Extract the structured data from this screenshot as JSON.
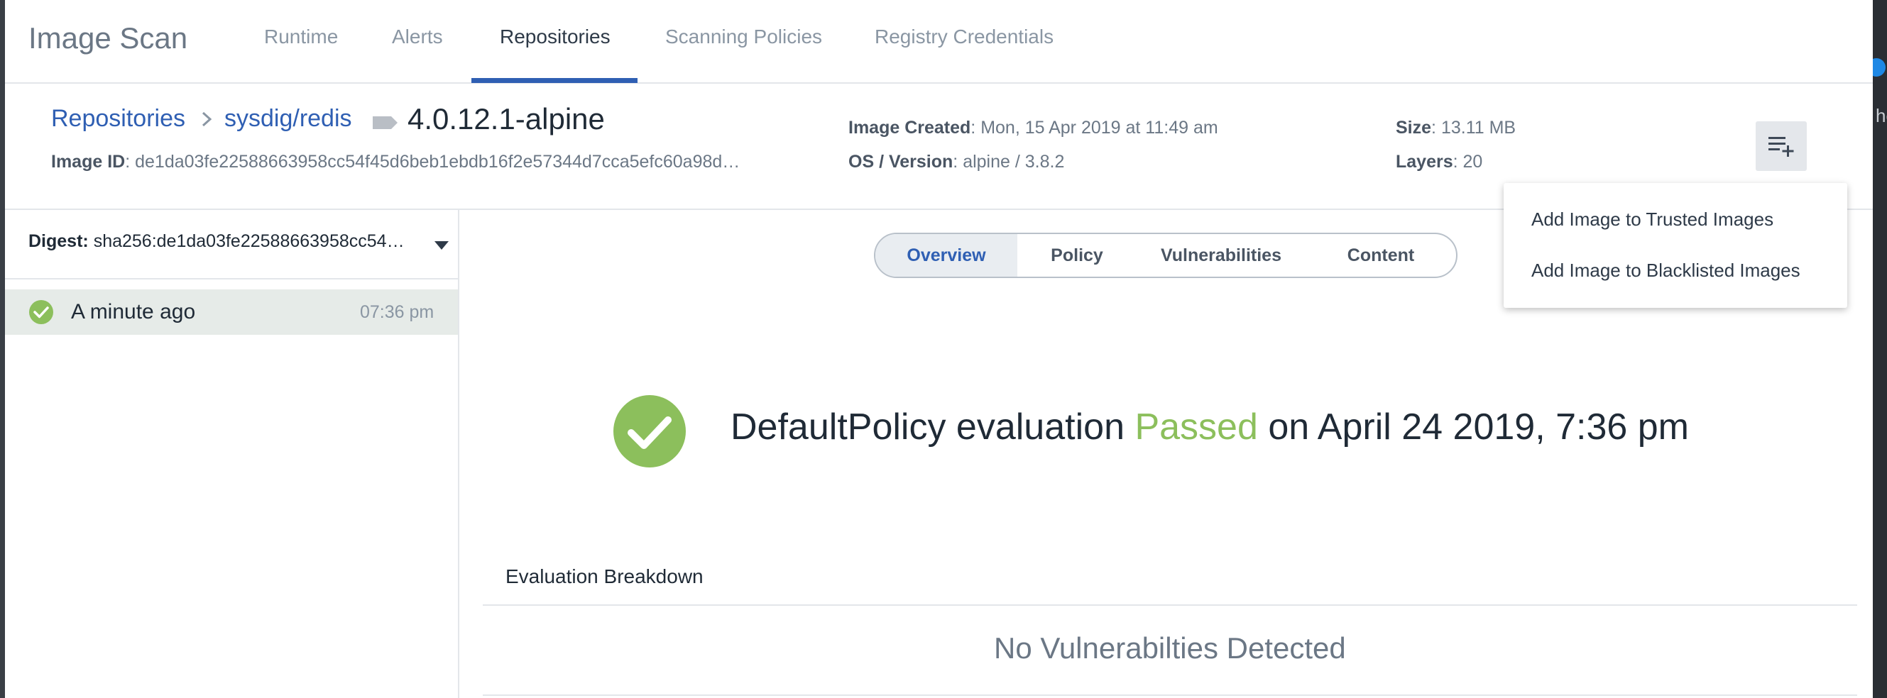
{
  "app": {
    "title": "Image Scan"
  },
  "nav": {
    "tabs": [
      {
        "label": "Runtime"
      },
      {
        "label": "Alerts"
      },
      {
        "label": "Repositories"
      },
      {
        "label": "Scanning Policies"
      },
      {
        "label": "Registry Credentials"
      }
    ],
    "active_tab": "Repositories"
  },
  "header": {
    "breadcrumb": {
      "root": "Repositories",
      "repo": "sysdig/redis"
    },
    "image_tag": "4.0.12.1-alpine",
    "image_id_label": "Image ID",
    "image_id_value": "de1da03fe22588663958cc54f45d6beb1ebdb16f2e57344d7cca5efc60a98d…",
    "created_label": "Image Created",
    "created_value": "Mon, 15 Apr 2019 at 11:49 am",
    "os_label": "OS / Version",
    "os_value": "alpine / 3.8.2",
    "size_label": "Size",
    "size_value": "13.11 MB",
    "layers_label": "Layers",
    "layers_value": "20"
  },
  "actions_menu": {
    "icon": "playlist-add-icon",
    "items": [
      {
        "label": "Add Image to Trusted Images"
      },
      {
        "label": "Add Image to Blacklisted Images"
      }
    ]
  },
  "left_panel": {
    "digest_label": "Digest:",
    "digest_value": "sha256:de1da03fe22588663958cc54…",
    "scans": [
      {
        "when": "A minute ago",
        "time": "07:36 pm",
        "status": "passed"
      }
    ]
  },
  "detail_tabs": {
    "items": [
      {
        "label": "Overview"
      },
      {
        "label": "Policy"
      },
      {
        "label": "Vulnerabilities"
      },
      {
        "label": "Content"
      }
    ],
    "active": "Overview"
  },
  "result": {
    "policy": "DefaultPolicy evaluation",
    "status": "Passed",
    "date": "on April 24 2019, 7:36 pm",
    "status_color": "#8cbf5c"
  },
  "breakdown": {
    "title": "Evaluation Breakdown",
    "empty_message": "No Vulnerabilties Detected"
  },
  "colors": {
    "accent": "#2f5fb3",
    "success": "#8cbf5c"
  }
}
